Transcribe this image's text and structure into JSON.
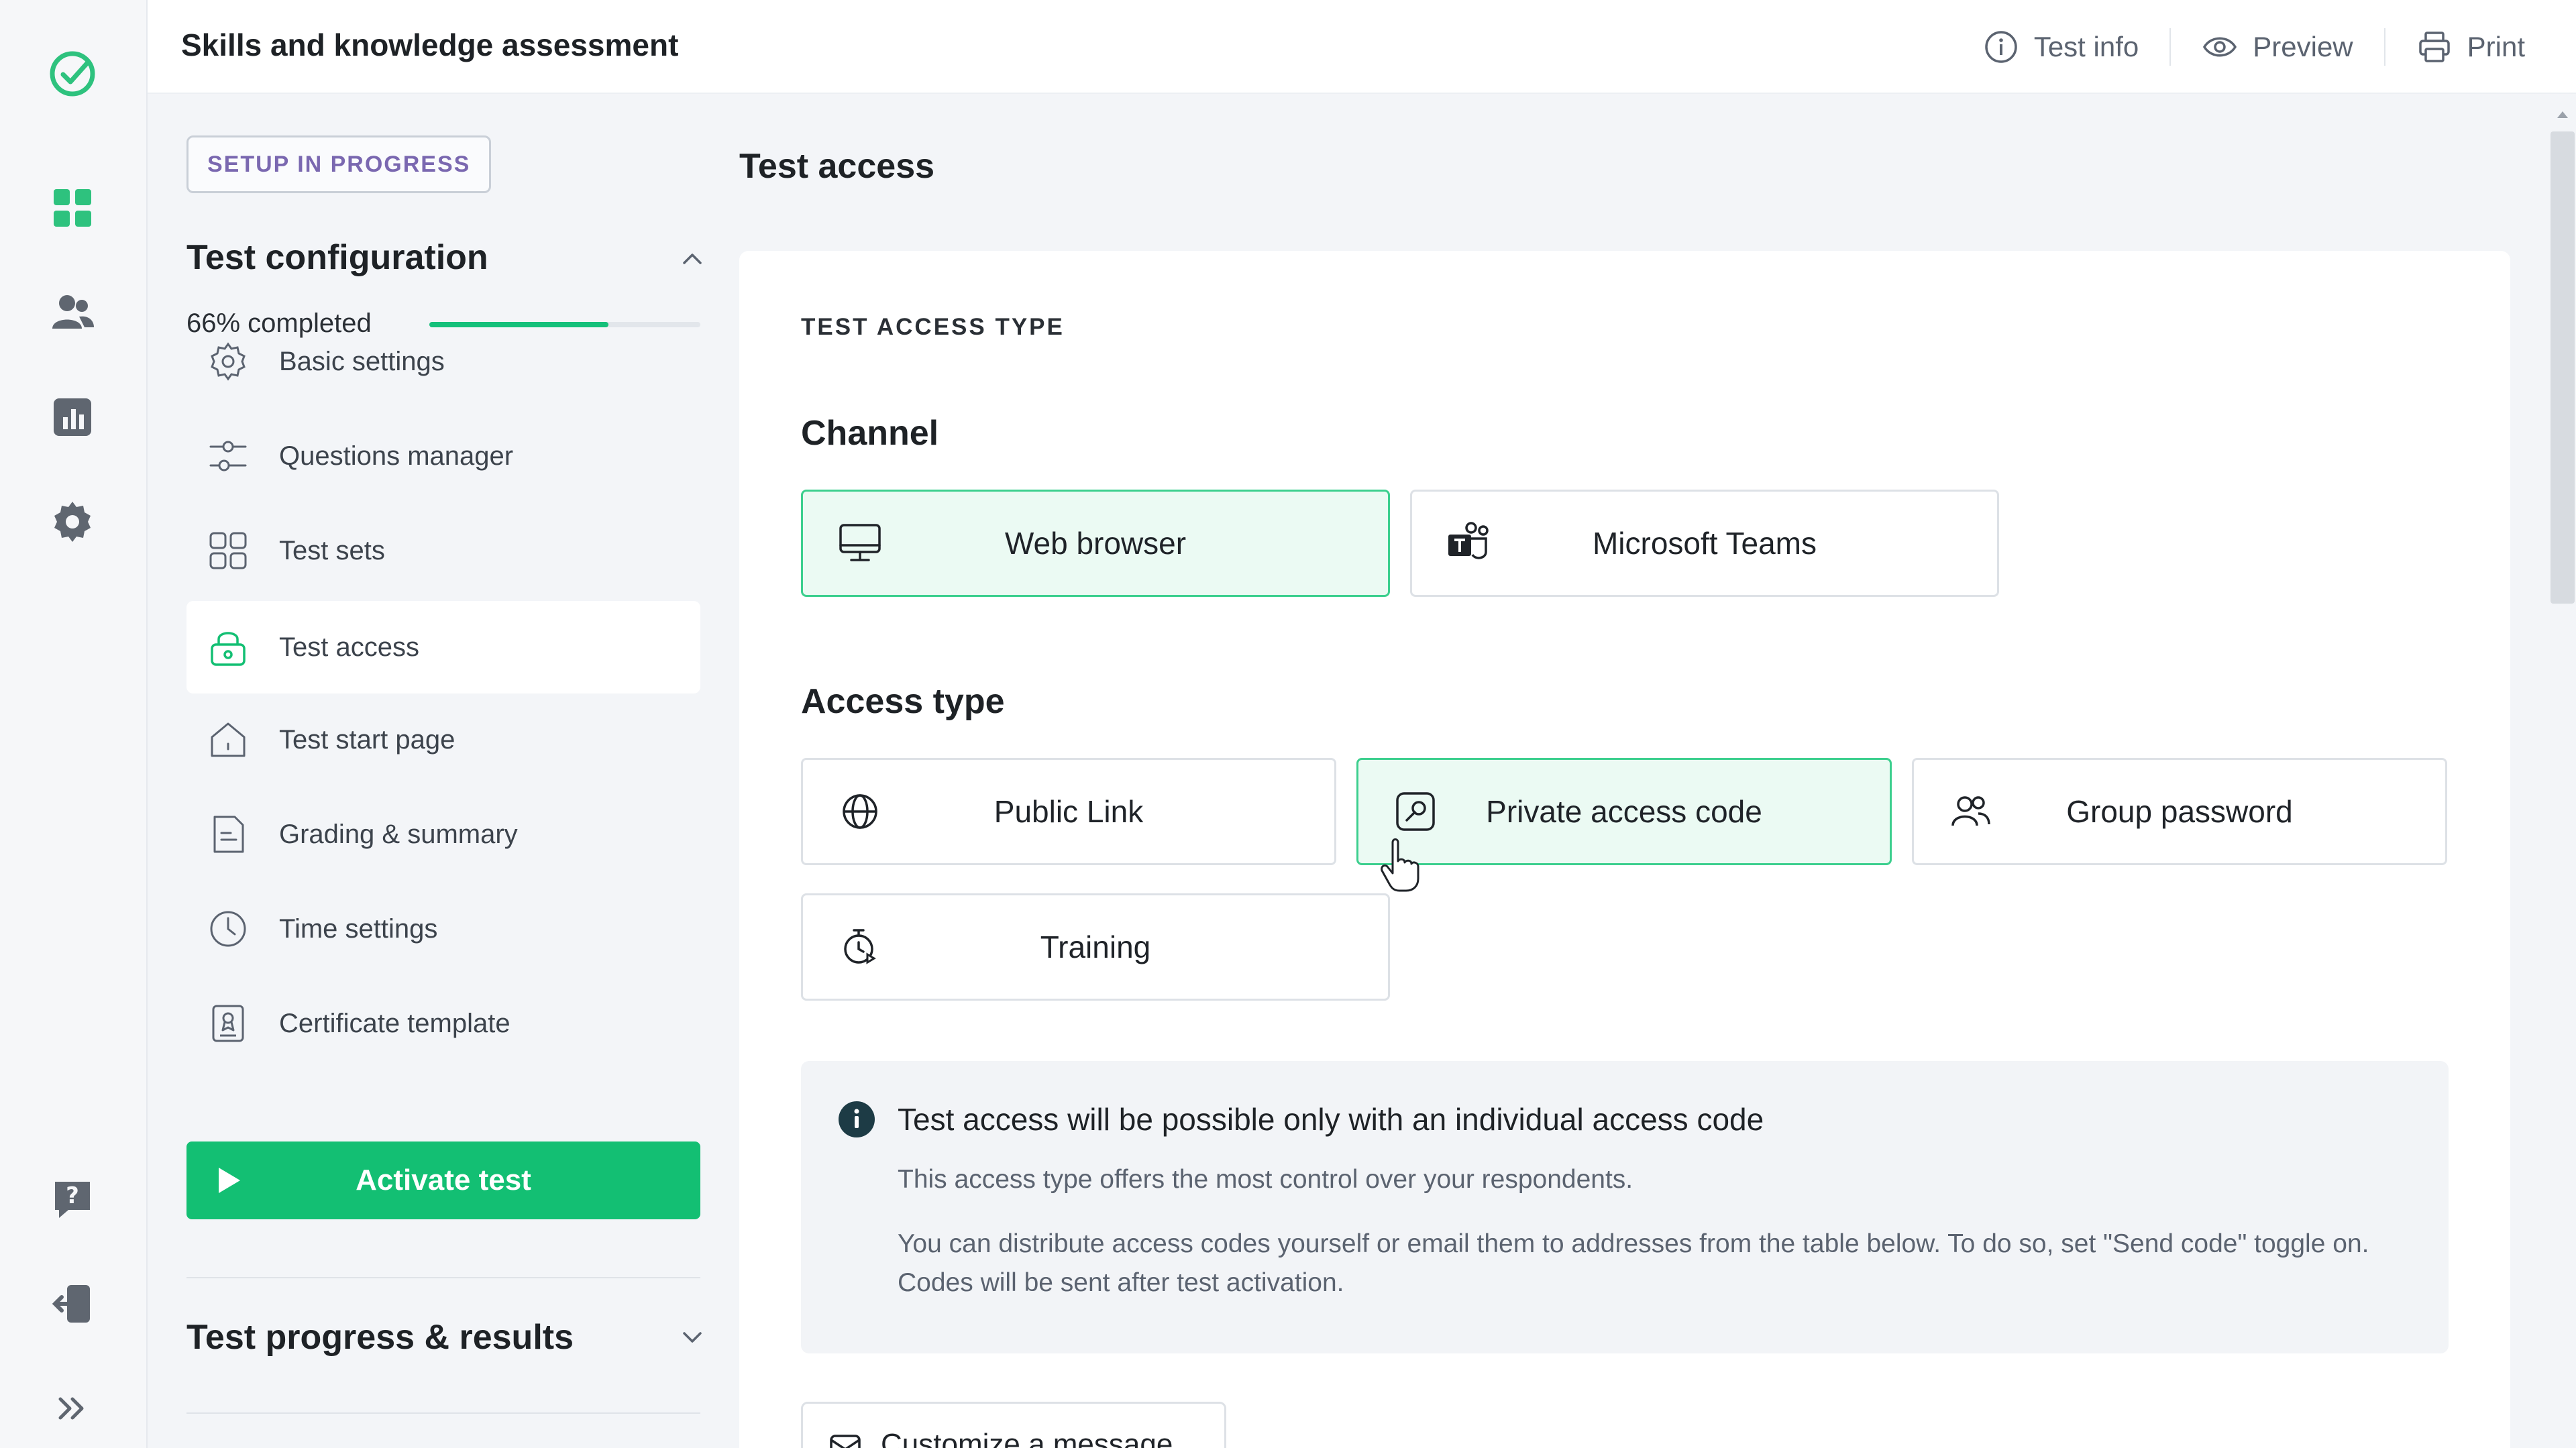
{
  "app": {
    "title": "Skills and knowledge assessment"
  },
  "topbar": {
    "actions": [
      {
        "label": "Test info",
        "icon": "info-icon"
      },
      {
        "label": "Preview",
        "icon": "eye-icon"
      },
      {
        "label": "Print",
        "icon": "printer-icon"
      }
    ]
  },
  "rail": {
    "icons": [
      "logo-icon",
      "dashboard-icon",
      "users-icon",
      "reports-icon",
      "settings-icon",
      "help-icon",
      "logout-icon",
      "expand-icon"
    ]
  },
  "panel": {
    "badge": "SETUP IN PROGRESS",
    "config_title": "Test configuration",
    "progress_label": "66% completed",
    "progress_fraction": 0.66,
    "menu": [
      {
        "label": "Basic settings",
        "icon": "gear-icon"
      },
      {
        "label": "Questions manager",
        "icon": "sliders-icon"
      },
      {
        "label": "Test sets",
        "icon": "grid-icon"
      },
      {
        "label": "Test access",
        "icon": "lock-icon",
        "active": true
      },
      {
        "label": "Test start page",
        "icon": "home-icon"
      },
      {
        "label": "Grading & summary",
        "icon": "document-icon"
      },
      {
        "label": "Time settings",
        "icon": "clock-icon"
      },
      {
        "label": "Certificate template",
        "icon": "certificate-icon"
      }
    ],
    "activate_label": "Activate test",
    "results_title": "Test progress & results"
  },
  "main": {
    "page_title": "Test access",
    "overline": "TEST ACCESS TYPE",
    "channel_title": "Channel",
    "channels": [
      {
        "label": "Web browser",
        "icon": "monitor-icon",
        "selected": true
      },
      {
        "label": "Microsoft Teams",
        "icon": "teams-icon",
        "selected": false
      }
    ],
    "access_title": "Access type",
    "access_types": [
      {
        "label": "Public Link",
        "icon": "globe-icon",
        "selected": false
      },
      {
        "label": "Private access code",
        "icon": "key-icon",
        "selected": true
      },
      {
        "label": "Group password",
        "icon": "group-icon",
        "selected": false
      },
      {
        "label": "Training",
        "icon": "timer-icon",
        "selected": false
      }
    ],
    "info": {
      "title": "Test access will be possible only with an individual access code",
      "line1": "This access type offers the most control over your respondents.",
      "line2": "You can distribute access codes yourself or email them to addresses from the table below. To do so, set \"Send code\" toggle on. Codes will be sent after test activation."
    },
    "customize_label": "Customize a message"
  },
  "colors": {
    "accent": "#13bf73",
    "selected_bg": "#ebfaf3",
    "selected_border": "#3ccf8e",
    "badge_text": "#7a68b0"
  }
}
